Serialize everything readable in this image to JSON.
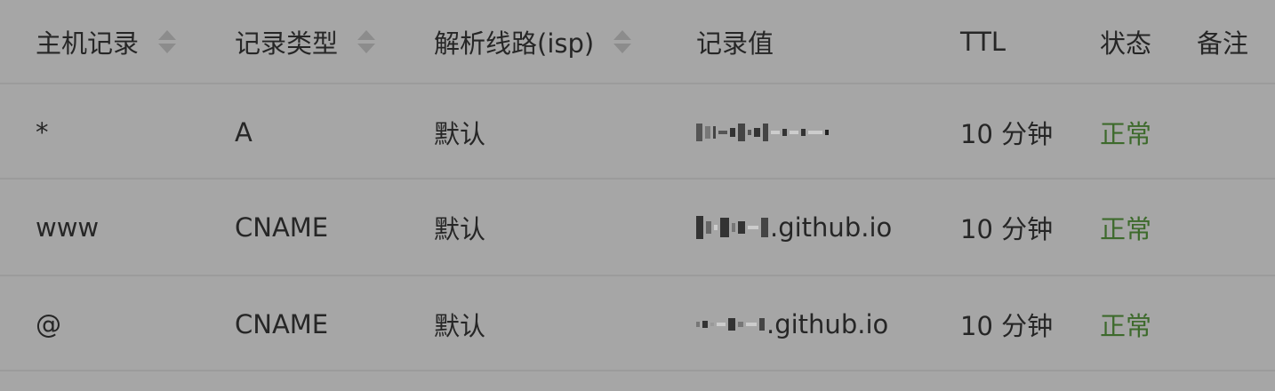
{
  "columns": [
    {
      "label": "主机记录"
    },
    {
      "label": "记录类型"
    },
    {
      "label": "解析线路(isp)"
    },
    {
      "label": "记录值"
    },
    {
      "label": "TTL"
    },
    {
      "label": "状态"
    },
    {
      "label": "备注"
    }
  ],
  "rows": [
    {
      "host": "*",
      "type": "A",
      "line": "默认",
      "value": "",
      "ttl": "10 分钟",
      "status": "正常",
      "note": ""
    },
    {
      "host": "www",
      "type": "CNAME",
      "line": "默认",
      "value": ".github.io",
      "ttl": "10 分钟",
      "status": "正常",
      "note": ""
    },
    {
      "host": "@",
      "type": "CNAME",
      "line": "默认",
      "value": ".github.io",
      "ttl": "10 分钟",
      "status": "正常",
      "note": ""
    }
  ],
  "colors": {
    "background": "#a6a6a6",
    "status": "#3d6a2c",
    "divider": "#9b9b9b"
  },
  "icons": {
    "sort": "sort-caret-icon"
  }
}
